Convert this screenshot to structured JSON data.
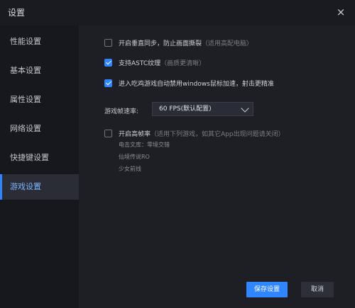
{
  "window": {
    "title": "设置",
    "close_icon": "×"
  },
  "sidebar": {
    "items": [
      {
        "label": "性能设置"
      },
      {
        "label": "基本设置"
      },
      {
        "label": "属性设置"
      },
      {
        "label": "网络设置"
      },
      {
        "label": "快捷键设置"
      },
      {
        "label": "游戏设置",
        "active": true
      }
    ]
  },
  "options": [
    {
      "label": "开启垂直同步，防止画面撕裂",
      "note": "（适用高配电脑）",
      "checked": false
    },
    {
      "label": "支持ASTC纹理",
      "note": "（画质更清晰）",
      "checked": true
    },
    {
      "label": "进入吃鸡游戏自动禁用windows鼠标加速，射击更精准",
      "note": "",
      "checked": true
    }
  ],
  "fps": {
    "label": "游戏帧速率:",
    "value": "60 FPS(默认配置)"
  },
  "high_fps": {
    "label": "开启高帧率",
    "note": "（适用下列游戏，如其它App出现问题请关闭）",
    "checked": false,
    "games": [
      "电击文库：零境交错",
      "仙境传说RO",
      "少女前线"
    ]
  },
  "buttons": {
    "save": "保存设置",
    "cancel": "取消"
  },
  "colors": {
    "accent": "#2f86ff",
    "background": "#1e1f25",
    "sidebar": "#17181d"
  }
}
